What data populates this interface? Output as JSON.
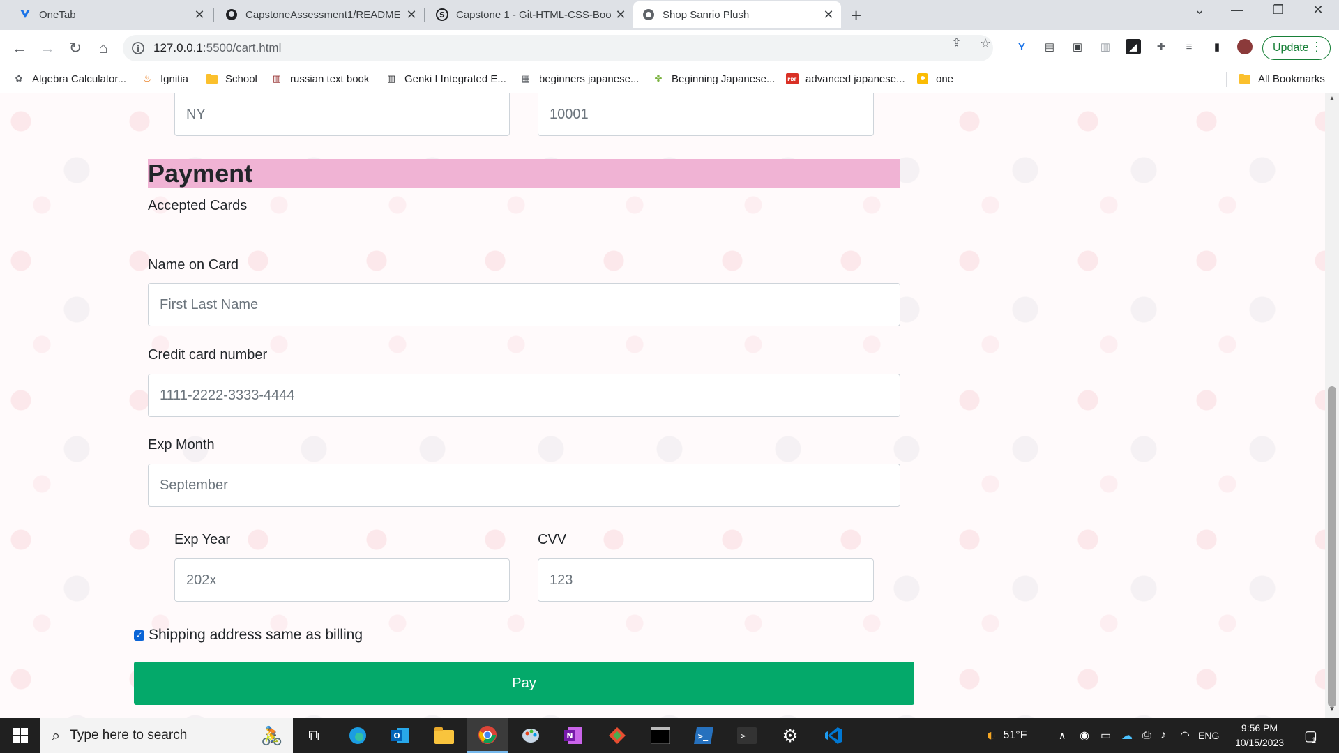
{
  "browser": {
    "tabs": [
      {
        "title": "OneTab",
        "icon": "onetab-icon"
      },
      {
        "title": "CapstoneAssessment1/README",
        "icon": "github-icon"
      },
      {
        "title": "Capstone 1 - Git-HTML-CSS-Boo",
        "icon": "skillstorm-icon"
      },
      {
        "title": "Shop Sanrio Plush",
        "icon": "globe-icon",
        "active": true
      }
    ],
    "url_host": "127.0.0.1",
    "url_rest": ":5500/cart.html",
    "update_label": "Update",
    "bookmarks": [
      {
        "label": "Algebra Calculator...",
        "icon": "paw-icon"
      },
      {
        "label": "Ignitia",
        "icon": "flame-icon"
      },
      {
        "label": "School",
        "icon": "folder-icon"
      },
      {
        "label": "russian text book",
        "icon": "book-icon"
      },
      {
        "label": "Genki I Integrated E...",
        "icon": "library-icon"
      },
      {
        "label": "beginners japanese...",
        "icon": "image-icon"
      },
      {
        "label": "Beginning Japanese...",
        "icon": "leaf-icon"
      },
      {
        "label": "advanced japanese...",
        "icon": "pdf-icon"
      },
      {
        "label": "one",
        "icon": "keep-icon"
      }
    ],
    "all_bookmarks_label": "All Bookmarks"
  },
  "form": {
    "state_value": "NY",
    "zip_value": "10001",
    "payment_title": "Payment",
    "accepted_cards": "Accepted Cards",
    "name_label": "Name on Card",
    "name_placeholder": "First Last Name",
    "card_label": "Credit card number",
    "card_placeholder": "1111-2222-3333-4444",
    "exp_month_label": "Exp Month",
    "exp_month_placeholder": "September",
    "exp_year_label": "Exp Year",
    "exp_year_placeholder": "202x",
    "cvv_label": "CVV",
    "cvv_placeholder": "123",
    "shipping_same_label": "Shipping address same as billing",
    "shipping_same_checked": true,
    "pay_label": "Pay",
    "colors": {
      "payment_header": "#f0b3d4",
      "pay_button": "#04a96a"
    }
  },
  "taskbar": {
    "search_placeholder": "Type here to search",
    "weather": "51°F",
    "language": "ENG",
    "time": "9:56 PM",
    "date": "10/15/2023",
    "notification_count": "1"
  }
}
